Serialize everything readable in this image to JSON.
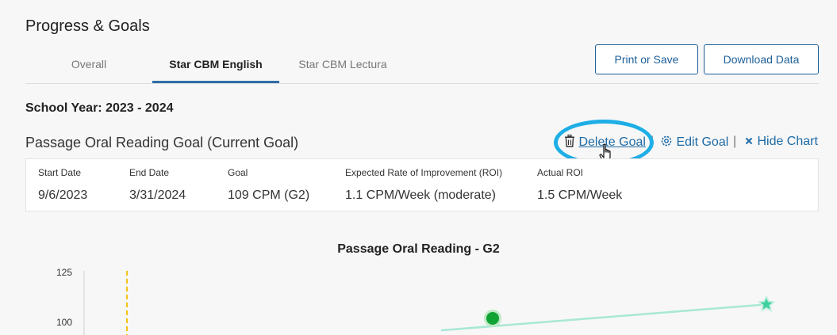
{
  "page": {
    "title": "Progress & Goals"
  },
  "tabs": [
    {
      "label": "Overall",
      "active": false
    },
    {
      "label": "Star CBM English",
      "active": true
    },
    {
      "label": "Star CBM Lectura",
      "active": false
    }
  ],
  "buttons": {
    "print": "Print or Save",
    "download": "Download Data"
  },
  "school_year": "School Year: 2023 - 2024",
  "goal": {
    "title": "Passage Oral Reading Goal (Current Goal)",
    "actions": {
      "delete": "Delete Goal",
      "edit": "Edit Goal",
      "hide": "Hide Chart",
      "separator": "|"
    },
    "columns": [
      {
        "header": "Start Date",
        "value": "9/6/2023"
      },
      {
        "header": "End Date",
        "value": "3/31/2024"
      },
      {
        "header": "Goal",
        "value": "109 CPM (G2)"
      },
      {
        "header": "Expected Rate of Improvement (ROI)",
        "value": "1.1 CPM/Week (moderate)"
      },
      {
        "header": "Actual ROI",
        "value": "1.5 CPM/Week"
      }
    ]
  },
  "chart_data": {
    "type": "line",
    "title": "Passage Oral Reading - G2",
    "y_ticks": [
      "125",
      "100"
    ],
    "ylim": [
      90,
      125
    ],
    "colors": {
      "goal_line": "#a8e8d4",
      "goal_star": "#3fd1a0",
      "score_point": "#12a335",
      "marker_line": "#f2c315",
      "axis": "#cfcfcf"
    },
    "goal_line": {
      "y_start": 96.0,
      "y_end": 109
    },
    "score_point": {
      "y": 102
    },
    "goal_marker": "star"
  }
}
